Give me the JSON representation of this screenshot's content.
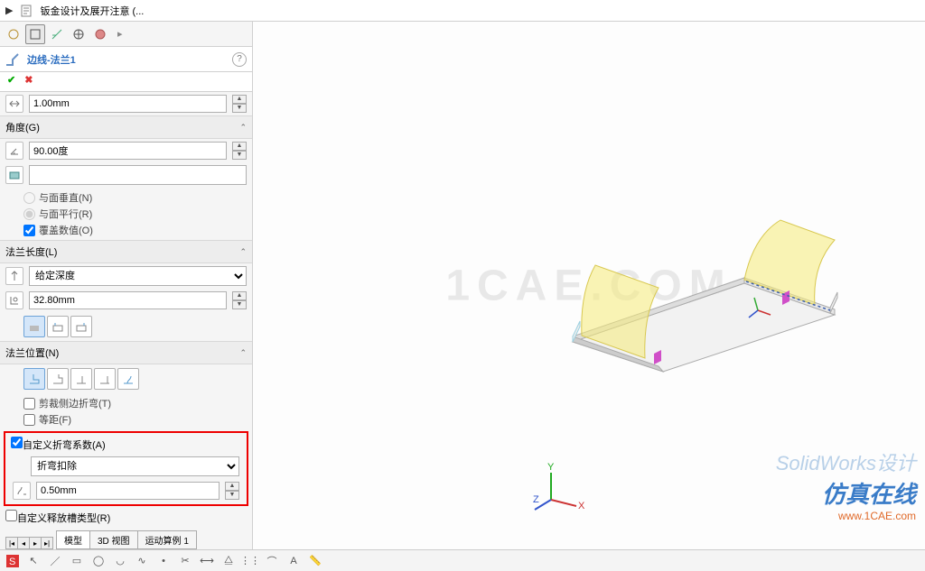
{
  "breadcrumb": {
    "title": "钣金设计及展开注意 (..."
  },
  "feature": {
    "title": "边线-法兰1"
  },
  "gap": {
    "value": "1.00mm"
  },
  "angle": {
    "header": "角度(G)",
    "value": "90.00度",
    "perp": "与面垂直(N)",
    "para": "与面平行(R)",
    "override": "覆盖数值(O)"
  },
  "length": {
    "header": "法兰长度(L)",
    "mode": "给定深度",
    "value": "32.80mm"
  },
  "position": {
    "header": "法兰位置(N)",
    "trim": "剪裁侧边折弯(T)",
    "equal": "等距(F)"
  },
  "bend": {
    "header": "自定义折弯系数(A)",
    "mode": "折弯扣除",
    "value": "0.50mm"
  },
  "relief": {
    "header": "自定义释放槽类型(R)"
  },
  "bottomTabs": {
    "a": "模型",
    "b": "3D 视图",
    "c": "运动算例 1"
  },
  "credit": {
    "a": "SolidWorks设计",
    "b": "仿真在线",
    "c": "www.1CAE.com"
  }
}
